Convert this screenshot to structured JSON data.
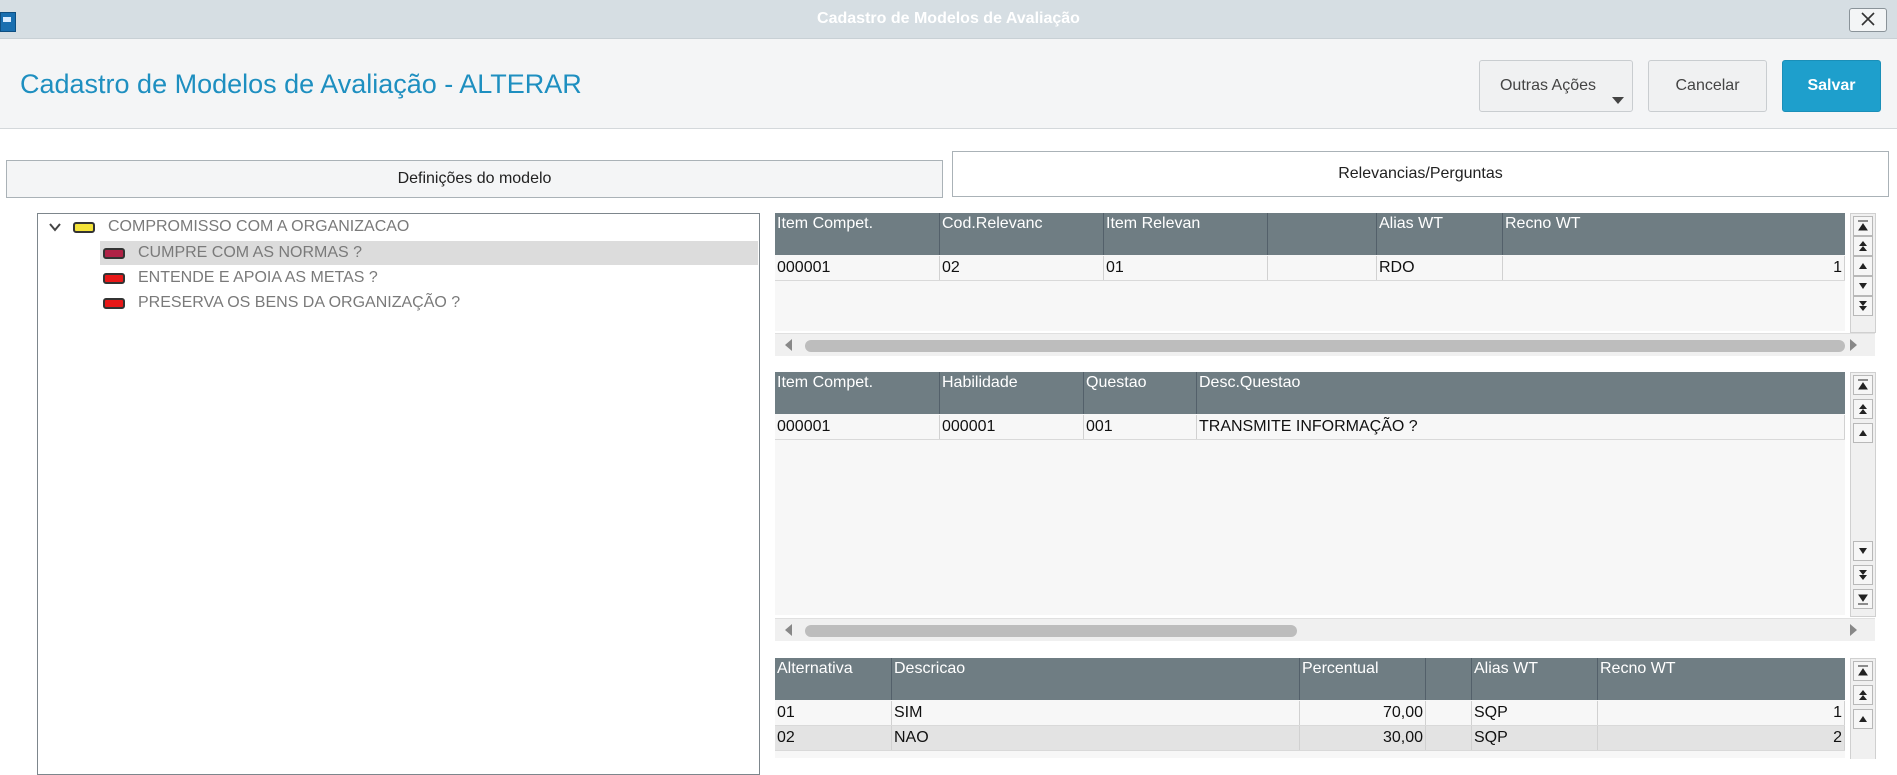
{
  "window": {
    "title": "Cadastro de Modelos de Avaliação"
  },
  "header": {
    "page_title": "Cadastro de Modelos de Avaliação - ALTERAR",
    "more_actions_label": "Outras Ações",
    "cancel_label": "Cancelar",
    "save_label": "Salvar"
  },
  "tabs": [
    {
      "label": "Definições do modelo",
      "active": false
    },
    {
      "label": "Relevancias/Perguntas",
      "active": true
    }
  ],
  "tree": {
    "root": {
      "label": "COMPROMISSO COM A ORGANIZACAO",
      "status": "yellow"
    },
    "children": [
      {
        "label": "CUMPRE COM AS NORMAS ?",
        "status": "maroon",
        "selected": true
      },
      {
        "label": "ENTENDE E APOIA AS METAS ?",
        "status": "red",
        "selected": false
      },
      {
        "label": "PRESERVA OS BENS DA ORGANIZAÇÃO ?",
        "status": "red",
        "selected": false
      }
    ]
  },
  "grid_relevancias": {
    "columns": [
      "Item Compet.",
      "Cod.Relevanc",
      "Item Relevan",
      "",
      "Alias WT",
      "Recno WT"
    ],
    "rows": [
      [
        "000001",
        "02",
        "01",
        "",
        "RDO",
        "1"
      ]
    ]
  },
  "grid_questoes": {
    "columns": [
      "Item Compet.",
      "Habilidade",
      "Questao",
      "Desc.Questao"
    ],
    "rows": [
      [
        "000001",
        "000001",
        "001",
        "TRANSMITE INFORMAÇÃO ?"
      ]
    ]
  },
  "grid_alternativas": {
    "columns": [
      "Alternativa",
      "Descricao",
      "Percentual",
      "",
      "Alias WT",
      "Recno WT"
    ],
    "rows": [
      [
        "01",
        "SIM",
        "70,00",
        "",
        "SQP",
        "1"
      ],
      [
        "02",
        "NAO",
        "30,00",
        "",
        "SQP",
        "2"
      ]
    ]
  },
  "colors": {
    "accent": "#1e8fc0",
    "save_button": "#1e9fcc",
    "grid_header": "#6f7d83"
  }
}
